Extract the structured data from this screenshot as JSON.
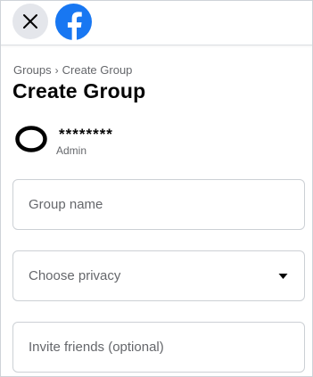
{
  "header": {
    "close_icon": "close-icon",
    "logo_icon": "facebook-logo-icon",
    "colors": {
      "brand": "#1877f2",
      "close_bg": "#e4e6eb"
    }
  },
  "breadcrumb": {
    "items": [
      "Groups",
      "Create Group"
    ],
    "separator": "›"
  },
  "page_title": "Create Group",
  "user": {
    "name": "********",
    "role": "Admin"
  },
  "form": {
    "group_name": {
      "placeholder": "Group name",
      "value": ""
    },
    "privacy": {
      "label": "Choose privacy"
    },
    "invite": {
      "placeholder": "Invite friends (optional)",
      "value": ""
    }
  }
}
